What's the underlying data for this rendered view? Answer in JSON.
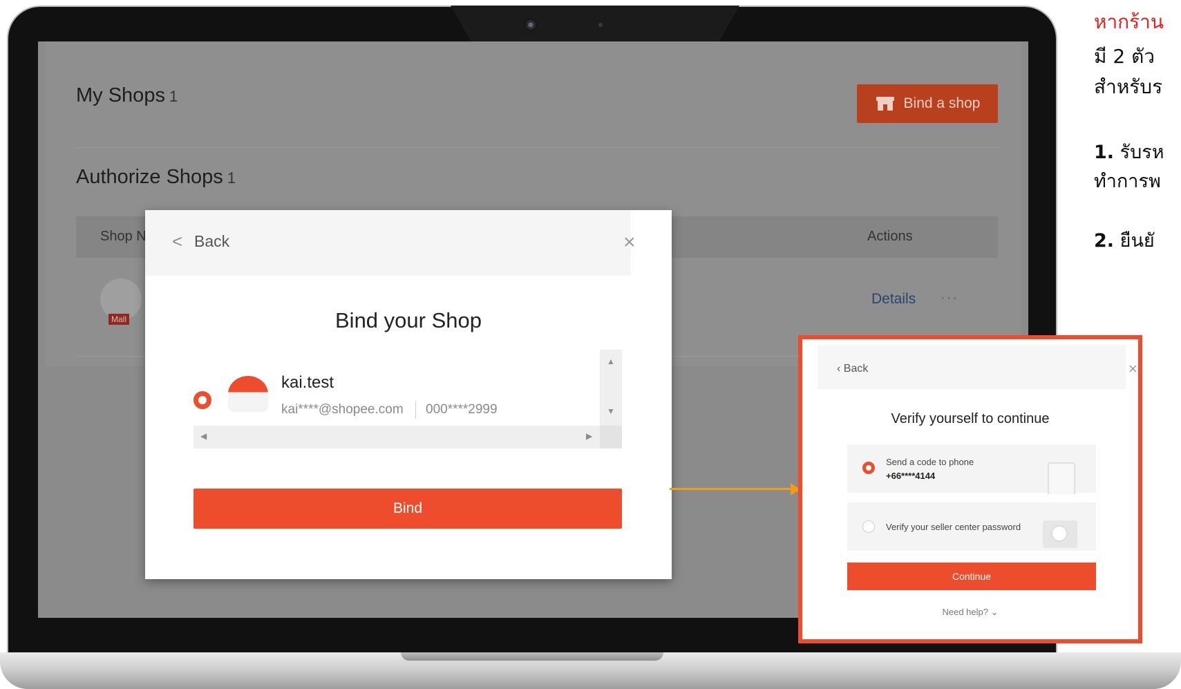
{
  "dashboard": {
    "my_shops_title": "My Shops",
    "my_shops_count": "1",
    "bind_shop_button": "Bind a shop",
    "authorize_shops_title": "Authorize Shops",
    "authorize_shops_count": "1",
    "table_headers": {
      "shop_name": "Shop Na",
      "actions": "Actions"
    },
    "row": {
      "badge": "Mall",
      "details": "Details",
      "more": "···"
    }
  },
  "bind_modal": {
    "back": "Back",
    "close": "×",
    "title": "Bind your Shop",
    "shop": {
      "name": "kai.test",
      "email": "kai****@shopee.com",
      "phone": "000****2999",
      "selected": true
    },
    "bind_button": "Bind"
  },
  "verify_panel": {
    "back": "Back",
    "close": "×",
    "title": "Verify yourself to continue",
    "options": [
      {
        "label": "Send a code to phone",
        "value": "+66****4144",
        "selected": true
      },
      {
        "label": "Verify your seller center password",
        "selected": false
      }
    ],
    "continue_button": "Continue",
    "help": "Need help? ⌄"
  },
  "side_text": {
    "line1": "หากร้าน",
    "line2": "มี 2 ตัว",
    "line3": "สำหรับร",
    "step1_num": "1.",
    "step1_text": " รับรห",
    "line5": "ทำการพ",
    "step2_num": "2.",
    "step2_text": " ยืนยั"
  },
  "colors": {
    "brand": "#ee4d2d",
    "arrow": "#f39a16",
    "side_heading": "#e8201c",
    "details_link": "#28456f"
  }
}
